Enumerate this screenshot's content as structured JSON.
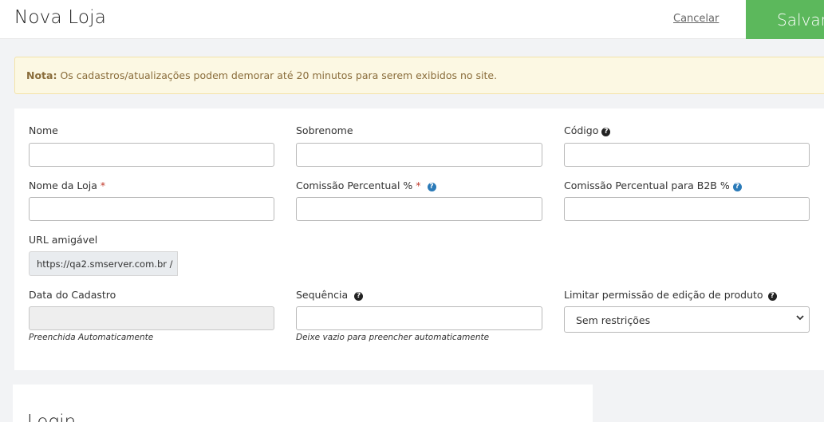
{
  "header": {
    "title": "Nova Loja",
    "cancel_label": "Cancelar",
    "save_label": "Salvar"
  },
  "notice": {
    "bold": "Nota:",
    "text": " Os cadastros/atualizações podem demorar até 20 minutos para serem exibidos no site."
  },
  "form": {
    "nome": {
      "label": "Nome",
      "value": ""
    },
    "sobrenome": {
      "label": "Sobrenome",
      "value": ""
    },
    "codigo": {
      "label": "Código",
      "value": ""
    },
    "nome_loja": {
      "label": "Nome da Loja",
      "required_mark": "*",
      "value": ""
    },
    "comissao": {
      "label": "Comissão Percentual %",
      "required_mark": "*",
      "value": ""
    },
    "comissao_b2b": {
      "label": "Comissão Percentual para B2B %",
      "value": ""
    },
    "url": {
      "label": "URL amigável",
      "prefix": "https://qa2.smserver.com.br /"
    },
    "data_cadastro": {
      "label": "Data do Cadastro",
      "value": "",
      "hint": "Preenchida Automaticamente"
    },
    "sequencia": {
      "label": "Sequência",
      "value": "",
      "hint": "Deixe vazio para preencher automaticamente"
    },
    "limitar": {
      "label": "Limitar permissão de edição de produto",
      "selected": "Sem restrições"
    }
  },
  "login": {
    "title": "Login"
  },
  "icons": {
    "help_dark": "question-circle-icon",
    "help_blue": "question-circle-blue-icon",
    "select": "chevron-down-icon"
  },
  "colors": {
    "save": "#5cb85c",
    "notice_bg": "#fcf8e3",
    "notice_text": "#8a6d3b",
    "required": "#c0392b",
    "help_blue": "#2a7ab8"
  }
}
